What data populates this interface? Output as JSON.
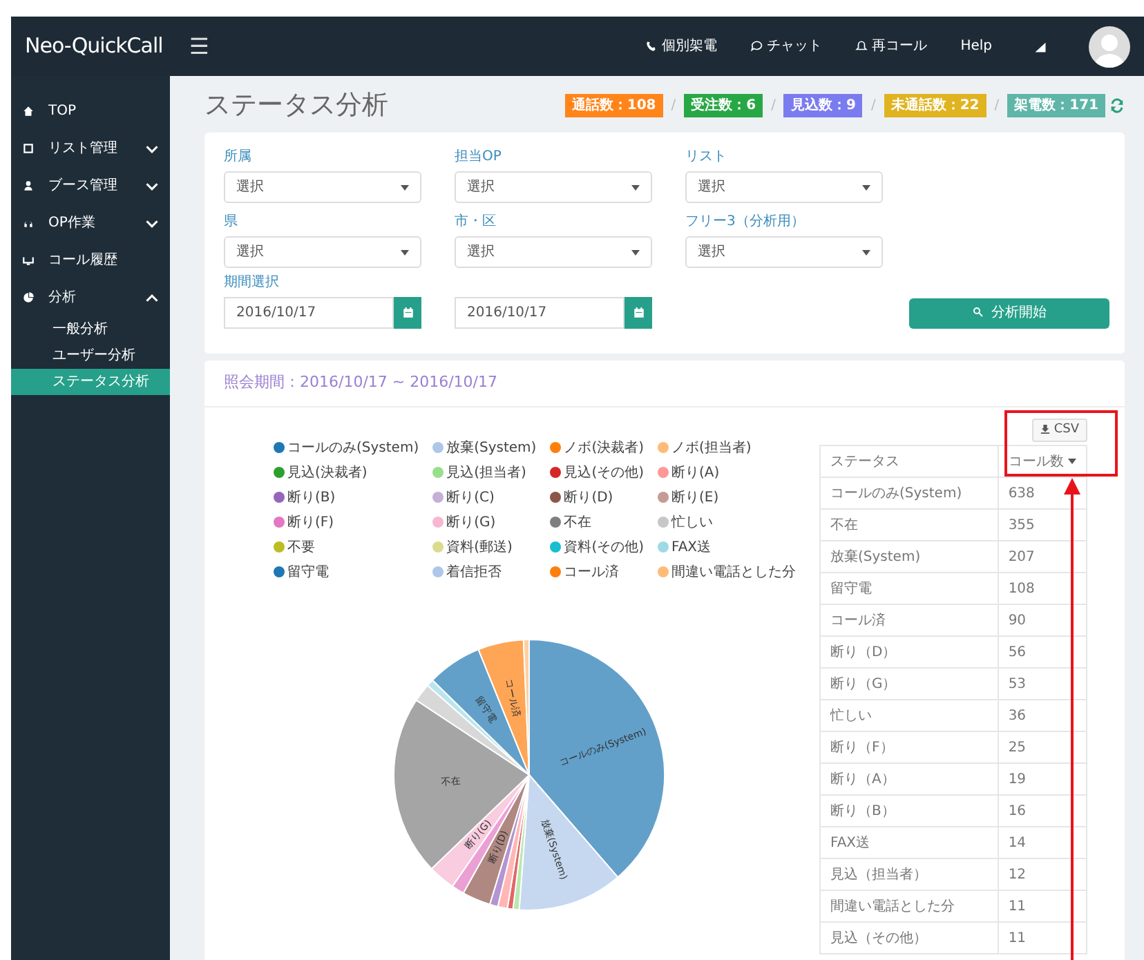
{
  "navbar": {
    "logo": "Neo-QuickCall",
    "menu_toggle": "☰",
    "links": [
      "個別架電",
      "チャット",
      "再コール",
      "Help"
    ]
  },
  "sidebar": {
    "items": [
      {
        "label": "TOP",
        "selected": false
      },
      {
        "label": "リスト管理",
        "expanded": false,
        "selected": false
      },
      {
        "label": "ブース管理",
        "expanded": false,
        "selected": false
      },
      {
        "label": "OP作業",
        "expanded": false,
        "selected": false
      },
      {
        "label": "コール履歴",
        "selected": false
      },
      {
        "label": "分析",
        "expanded": true,
        "selected": false,
        "children": [
          {
            "label": "一般分析",
            "selected": false
          },
          {
            "label": "ユーザー分析",
            "selected": false
          },
          {
            "label": "ステータス分析",
            "selected": true
          }
        ]
      }
    ]
  },
  "page_title": "ステータス分析",
  "badges": [
    {
      "text": "通話数：108",
      "color": "#ff851b",
      "separator": "/"
    },
    {
      "text": "受注数：6",
      "color": "#28a745",
      "separator": "/"
    },
    {
      "text": "見込数：9",
      "color": "#7b7bf0",
      "separator": "/"
    },
    {
      "text": "未通話数：22",
      "color": "#e0b320",
      "separator": "/"
    },
    {
      "text": "架電数：171",
      "color": "#5fb6a8"
    }
  ],
  "filters": {
    "selects": [
      {
        "label": "所属",
        "value": "選択"
      },
      {
        "label": "担当OP",
        "value": "選択"
      },
      {
        "label": "リスト",
        "value": "選択"
      },
      {
        "label": "県",
        "value": "選択"
      },
      {
        "label": "市・区",
        "value": "選択"
      },
      {
        "label": "フリー3（分析用）",
        "value": "選択"
      }
    ],
    "period_label": "期間選択",
    "date_from": "2016/10/17",
    "date_to": "2016/10/17",
    "submit": "分析開始"
  },
  "report": {
    "title": "照会期間：2016/10/17 ~ 2016/10/17",
    "chart_data": {
      "type": "pie",
      "categories": [
        "コールのみ(System)",
        "放棄(System)",
        "ノボ(決裁者)",
        "ノボ(担当者)",
        "見込(決裁者)",
        "見込(担当者)",
        "見込(その他)",
        "断り(A)",
        "断り(B)",
        "断り(C)",
        "断り(D)",
        "断り(E)",
        "断り(F)",
        "断り(G)",
        "不在",
        "忙しい",
        "不要",
        "資料(郵送)",
        "資料(その他)",
        "FAX送",
        "留守電",
        "着信拒否",
        "コール済",
        "間違い電話とした分"
      ],
      "values": [
        38.64,
        12.54,
        null,
        null,
        null,
        0.73,
        0.67,
        1.15,
        0.97,
        null,
        3.39,
        null,
        1.51,
        3.21,
        21.5,
        2.18,
        null,
        null,
        null,
        0.85,
        6.54,
        null,
        5.45,
        0.67
      ],
      "colors": [
        "#1f77b4",
        "#aec7e8",
        "#ff7f0e",
        "#ffbb78",
        "#2ca02c",
        "#98df8a",
        "#d62728",
        "#ff9896",
        "#9467bd",
        "#c5b0d5",
        "#8c564b",
        "#c49c94",
        "#e377c2",
        "#f7b6d2",
        "#7f7f7f",
        "#c7c7c7",
        "#bcbd22",
        "#dbdb8d",
        "#17becf",
        "#9edae5",
        "#1f77b4",
        "#aec7e8",
        "#ff7f0e",
        "#ffbb78"
      ]
    },
    "csv_button": "CSV",
    "table": {
      "columns": [
        "ステータス",
        "コール数"
      ],
      "rows": [
        [
          "コールのみ(System)",
          "638"
        ],
        [
          "不在",
          "355"
        ],
        [
          "放棄(System)",
          "207"
        ],
        [
          "留守電",
          "108"
        ],
        [
          "コール済",
          "90"
        ],
        [
          "断り（D）",
          "56"
        ],
        [
          "断り（G）",
          "53"
        ],
        [
          "忙しい",
          "36"
        ],
        [
          "断り（F）",
          "25"
        ],
        [
          "断り（A）",
          "19"
        ],
        [
          "断り（B）",
          "16"
        ],
        [
          "FAX送",
          "14"
        ],
        [
          "見込（担当者）",
          "12"
        ],
        [
          "間違い電話とした分",
          "11"
        ],
        [
          "見込（その他）",
          "11"
        ]
      ]
    }
  },
  "callout": {
    "shown": true
  }
}
